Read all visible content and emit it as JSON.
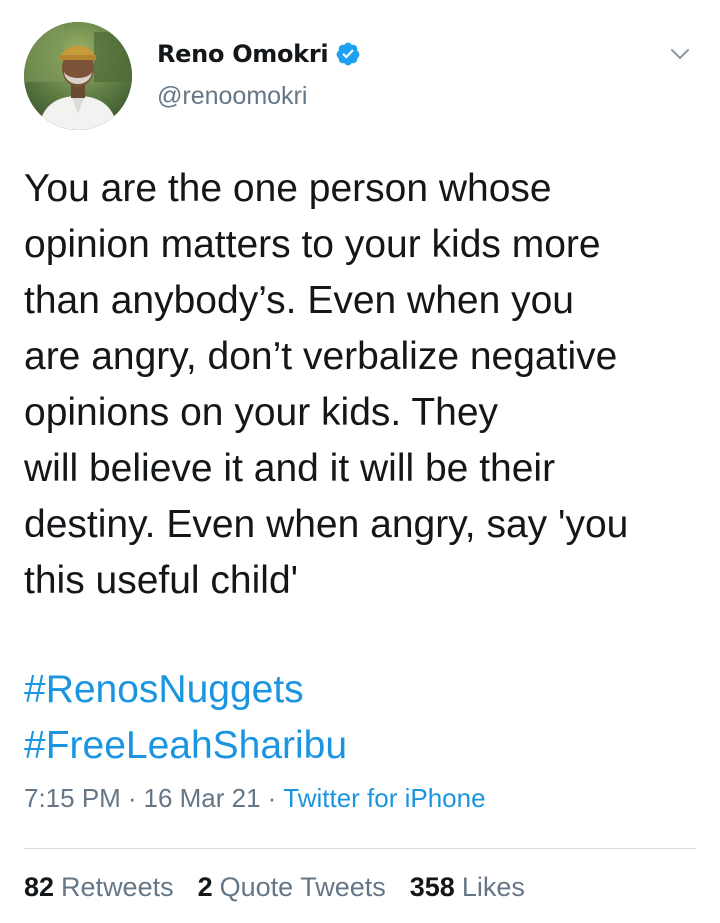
{
  "author": {
    "display_name": "Reno Omokri",
    "handle": "@renoomokri",
    "verified": true
  },
  "tweet": {
    "text": "You are the one person whose\nopinion matters to your kids more\nthan anybody’s. Even when you\nare angry, don’t verbalize negative\nopinions on your kids. They\nwill believe it and it will be their\ndestiny. Even when angry, say 'you\nthis useful child'",
    "hashtags": [
      "#RenosNuggets",
      "#FreeLeahSharibu"
    ],
    "time": "7:15 PM",
    "date": "16 Mar 21",
    "source": "Twitter for iPhone",
    "separator": "·"
  },
  "stats": {
    "retweets": {
      "count": "82",
      "label": "Retweets"
    },
    "quote_tweets": {
      "count": "2",
      "label": "Quote Tweets"
    },
    "likes": {
      "count": "358",
      "label": "Likes"
    }
  },
  "colors": {
    "link": "#1b95e0",
    "muted": "#657786",
    "text": "#14171a",
    "verified_badge": "#1da1f2"
  },
  "icons": {
    "verified": "verified-badge-icon",
    "caret": "chevron-down-icon"
  }
}
